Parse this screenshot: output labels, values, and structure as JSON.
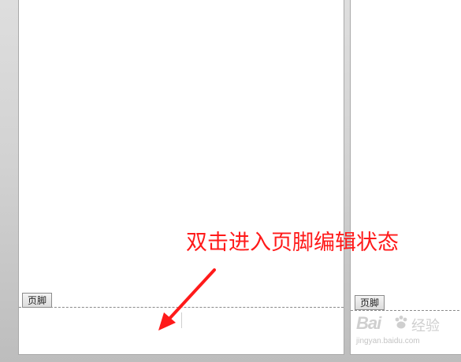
{
  "pages": {
    "left": {
      "footer_tag": "页脚"
    },
    "right": {
      "footer_tag": "页脚"
    }
  },
  "annotation": {
    "text": "双击进入页脚编辑状态",
    "color": "#ff1a1a"
  },
  "watermark": {
    "logo_text": "Bai",
    "logo_suffix": "经验",
    "url": "jingyan.baidu.com"
  }
}
